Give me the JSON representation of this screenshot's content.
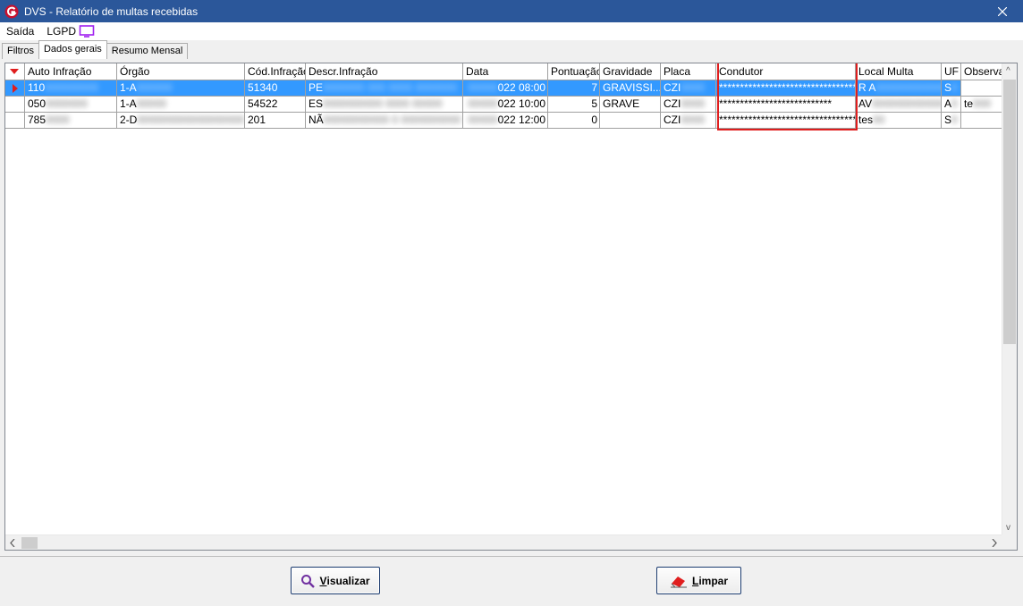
{
  "window": {
    "title": "DVS - Relatório de multas recebidas"
  },
  "menu": {
    "items": [
      "Saída",
      "LGPD"
    ]
  },
  "tabs": [
    {
      "label": "Filtros",
      "active": false
    },
    {
      "label": "Dados gerais",
      "active": true
    },
    {
      "label": "Resumo Mensal",
      "active": false
    }
  ],
  "grid": {
    "columns": [
      "Auto Infração",
      "Órgão",
      "Cód.Infração",
      "Descr.Infração",
      "Data",
      "Pontuação",
      "Gravidade",
      "Placa",
      "Condutor",
      "Local Multa",
      "UF",
      "Observa"
    ],
    "rows": [
      {
        "auto": "110",
        "auto_blur": "000000000",
        "orgao": "1-A",
        "orgao_blur": "000000",
        "cod": "51340",
        "descr": "PE",
        "descr_blur": "0000000 000 0000 0000000",
        "data": "022 08:00",
        "data_blur": "00000",
        "pontuacao": "7",
        "gravidade": "GRAVISSI...",
        "placa": "CZI",
        "placa_blur": "0000",
        "condutor": "***************************************",
        "local": "R A",
        "local_blur": "000000000000",
        "uf": "S",
        "uf_blur": "0",
        "obs": ""
      },
      {
        "auto": "050",
        "auto_blur": "0000000",
        "orgao": "1-A",
        "orgao_blur": "00000",
        "cod": "54522",
        "descr": "ES",
        "descr_blur": "0000000000 0000 00000",
        "data": "022 10:00",
        "data_blur": "00000",
        "pontuacao": "5",
        "gravidade": "GRAVE",
        "placa": "CZI",
        "placa_blur": "0000",
        "condutor": "***************************",
        "local": "AV",
        "local_blur": "000000000000",
        "uf": "A",
        "uf_blur": "0",
        "obs": "te",
        "obs_blur": "000"
      },
      {
        "auto": "785",
        "auto_blur": "0000",
        "orgao": "2-D",
        "orgao_blur": "000000000000000000",
        "cod": "201",
        "descr": "NÃ",
        "descr_blur": "00000000000 0 0000000000",
        "data": "022 12:00",
        "data_blur": "00000",
        "pontuacao": "0",
        "gravidade": "",
        "placa": "CZI",
        "placa_blur": "0000",
        "condutor": "*****************************************",
        "local": "tes",
        "local_blur": "00",
        "uf": "S",
        "uf_blur": "0",
        "obs": ""
      }
    ]
  },
  "buttons": {
    "visualizar": {
      "accel": "V",
      "rest": "isualizar"
    },
    "limpar": {
      "accel": "L",
      "rest": "impar"
    }
  },
  "colors": {
    "titlebar": "#2b579a",
    "selection": "#3399ff",
    "highlight": "#e01e1e"
  }
}
